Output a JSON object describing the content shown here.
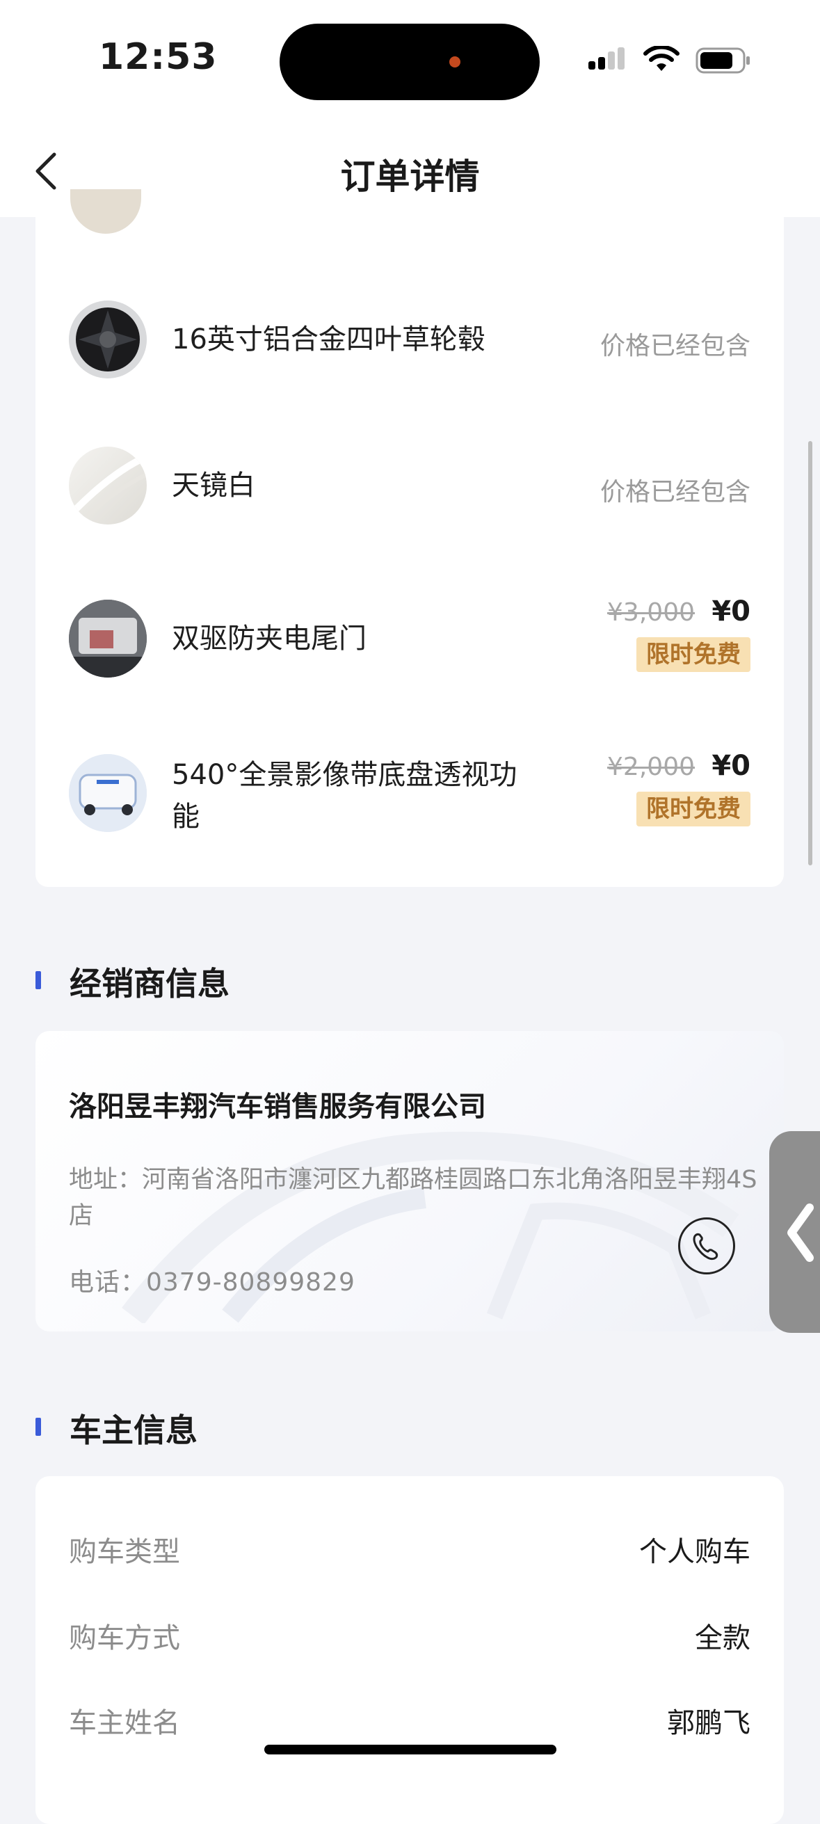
{
  "status_bar": {
    "time": "12:53"
  },
  "nav": {
    "title": "订单详情"
  },
  "options": [
    {
      "name": "16英寸铝合金四叶草轮毂",
      "price_note": "价格已经包含",
      "thumb": "wheel-thumbnail"
    },
    {
      "name": "天镜白",
      "price_note": "价格已经包含",
      "thumb": "white-paint-thumbnail"
    },
    {
      "name": "双驱防夹电尾门",
      "original_price": "¥3,000",
      "price": "¥0",
      "badge": "限时免费",
      "thumb": "tailgate-thumbnail"
    },
    {
      "name": "540°全景影像带底盘透视功能",
      "original_price": "¥2,000",
      "price": "¥0",
      "badge": "限时免费",
      "thumb": "camera-thumbnail"
    }
  ],
  "dealer": {
    "section_title": "经销商信息",
    "name": "洛阳昱丰翔汽车销售服务有限公司",
    "address": "地址：河南省洛阳市瀍河区九都路桂圆路口东北角洛阳昱丰翔4S店",
    "phone": "电话：0379-80899829"
  },
  "owner": {
    "section_title": "车主信息",
    "rows": [
      {
        "label": "购车类型",
        "value": "个人购车"
      },
      {
        "label": "购车方式",
        "value": "全款"
      },
      {
        "label": "车主姓名",
        "value": "郭鹏飞"
      }
    ]
  },
  "colors": {
    "accent": "#3a5bd9",
    "badge_bg": "#f8e0b3",
    "badge_text": "#b0732a"
  }
}
